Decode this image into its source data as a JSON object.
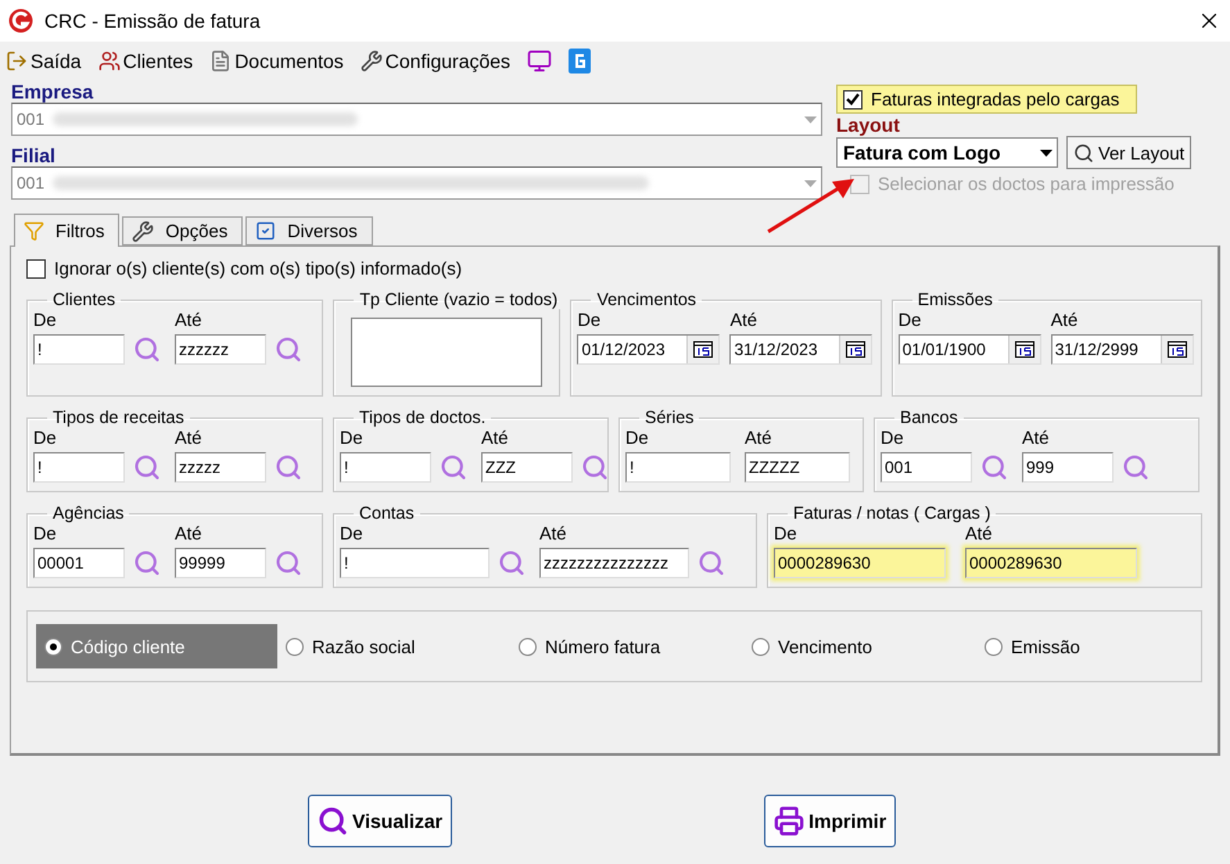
{
  "window": {
    "title": "CRC - Emissão de fatura"
  },
  "toolbar": [
    {
      "label": "Saída",
      "kind": "exit"
    },
    {
      "label": "Clientes",
      "kind": "people"
    },
    {
      "label": "Documentos",
      "kind": "document"
    },
    {
      "label": "Configurações",
      "kind": "tools"
    },
    {
      "kind": "monitor"
    },
    {
      "kind": "logo"
    }
  ],
  "empresa": {
    "label": "Empresa",
    "value": "001"
  },
  "filial": {
    "label": "Filial",
    "value": "001"
  },
  "cargas_checkbox": {
    "label": "Faturas integradas pelo cargas",
    "checked": true
  },
  "layout": {
    "label": "Layout",
    "value": "Fatura com Logo",
    "button": "Ver Layout"
  },
  "select_docs": {
    "label": "Selecionar os doctos para impressão",
    "checked": false,
    "disabled": true
  },
  "tabs": [
    {
      "label": "Filtros",
      "kind": "filter",
      "selected": true
    },
    {
      "label": "Opções",
      "kind": "tools",
      "selected": false
    },
    {
      "label": "Diversos",
      "kind": "check",
      "selected": false
    }
  ],
  "ignore_checkbox": {
    "label": "Ignorar o(s) cliente(s) com o(s) tipo(s) informado(s)",
    "checked": false
  },
  "filter_rows": [
    [
      {
        "title": "Clientes",
        "kind": "range",
        "fields": [
          {
            "label": "De",
            "value": "!",
            "kind": "lookup"
          },
          {
            "label": "Até",
            "value": "zzzzzz",
            "kind": "lookup"
          }
        ]
      },
      {
        "title": "Tp Cliente (vazio = todos)",
        "kind": "list"
      },
      {
        "title": "Vencimentos",
        "kind": "range",
        "fields": [
          {
            "label": "De",
            "value": "01/12/2023",
            "kind": "date"
          },
          {
            "label": "Até",
            "value": "31/12/2023",
            "kind": "date"
          }
        ]
      },
      {
        "title": "Emissões",
        "kind": "range",
        "fields": [
          {
            "label": "De",
            "value": "01/01/1900",
            "kind": "date"
          },
          {
            "label": "Até",
            "value": "31/12/2999",
            "kind": "date"
          }
        ]
      }
    ],
    [
      {
        "title": "Tipos de receitas",
        "kind": "range",
        "fields": [
          {
            "label": "De",
            "value": "!",
            "kind": "lookup"
          },
          {
            "label": "Até",
            "value": "zzzzz",
            "kind": "lookup"
          }
        ]
      },
      {
        "title": "Tipos de doctos.",
        "kind": "range",
        "fields": [
          {
            "label": "De",
            "value": "!",
            "kind": "lookup"
          },
          {
            "label": "Até",
            "value": "ZZZ",
            "kind": "lookup"
          }
        ]
      },
      {
        "title": "Séries",
        "kind": "range",
        "fields": [
          {
            "label": "De",
            "value": "!",
            "kind": "plain"
          },
          {
            "label": "Até",
            "value": "ZZZZZ",
            "kind": "plain"
          }
        ]
      },
      {
        "title": "Bancos",
        "kind": "range",
        "fields": [
          {
            "label": "De",
            "value": "001",
            "kind": "lookup"
          },
          {
            "label": "Até",
            "value": "999",
            "kind": "lookup"
          }
        ]
      }
    ],
    [
      {
        "title": "Agências",
        "kind": "range",
        "fields": [
          {
            "label": "De",
            "value": "00001",
            "kind": "lookup"
          },
          {
            "label": "Até",
            "value": "99999",
            "kind": "lookup"
          }
        ]
      },
      {
        "title": "Contas",
        "kind": "range",
        "fields": [
          {
            "label": "De",
            "value": "!",
            "kind": "lookup"
          },
          {
            "label": "Até",
            "value": "zzzzzzzzzzzzzzz",
            "kind": "lookup"
          }
        ]
      },
      {
        "title": "Faturas / notas ( Cargas )",
        "kind": "range",
        "fields": [
          {
            "label": "De",
            "value": "0000289630",
            "kind": "highlight"
          },
          {
            "label": "Até",
            "value": "0000289630",
            "kind": "highlight"
          }
        ]
      }
    ]
  ],
  "sort_options": [
    {
      "label": "Código cliente",
      "selected": true
    },
    {
      "label": "Razão social",
      "selected": false
    },
    {
      "label": "Número fatura",
      "selected": false
    },
    {
      "label": "Vencimento",
      "selected": false
    },
    {
      "label": "Emissão",
      "selected": false
    }
  ],
  "buttons": [
    {
      "label": "Visualizar",
      "kind": "search"
    },
    {
      "label": "Imprimir",
      "kind": "print"
    }
  ]
}
